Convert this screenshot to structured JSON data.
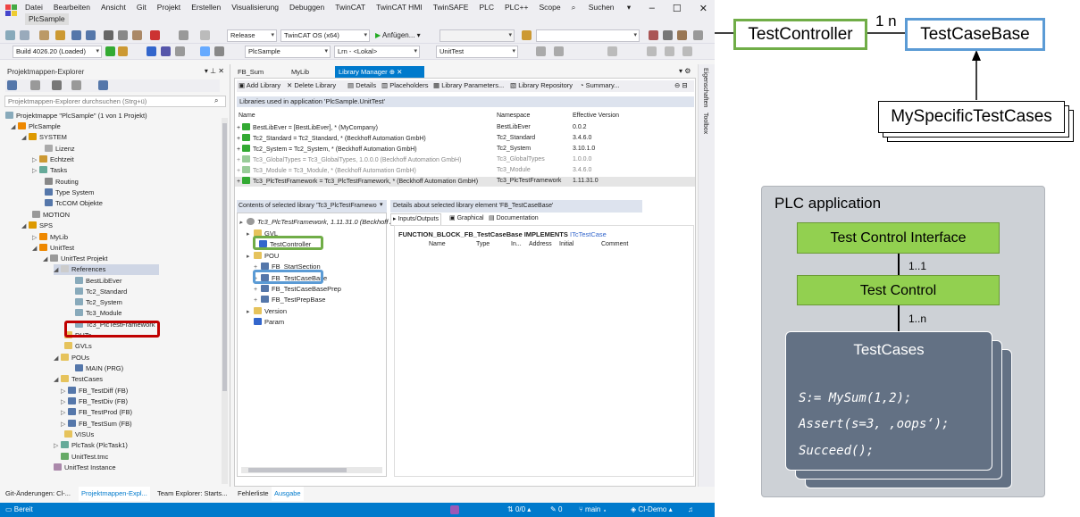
{
  "menu": {
    "items": [
      "Datei",
      "Bearbeiten",
      "Ansicht",
      "Git",
      "Projekt",
      "Erstellen",
      "Visualisierung",
      "Debuggen",
      "TwinCAT",
      "TwinCAT HMI",
      "TwinSAFE",
      "PLC",
      "PLC++",
      "Scope"
    ],
    "items2": [
      "Extras",
      "Fenster",
      "Hilfe"
    ],
    "search": "Suchen",
    "window_title": "PlcSample"
  },
  "toolbar": {
    "config": "Release",
    "platform": "TwinCAT OS (x64)",
    "start": "Anfügen...",
    "build": "Build 4026.20 (Loaded)",
    "project": "PlcSample",
    "target": "Lrn - <Lokal>",
    "task": "UnitTest"
  },
  "explorer": {
    "title": "Projektmappen-Explorer",
    "search_placeholder": "Projektmappen-Explorer durchsuchen (Strg+ü)",
    "items": [
      "Projektmappe \"PlcSample\" (1 von 1 Projekt)",
      "PlcSample",
      "SYSTEM",
      "Lizenz",
      "Echtzeit",
      "Tasks",
      "Routing",
      "Type System",
      "TcCOM Objekte",
      "MOTION",
      "SPS",
      "MyLib",
      "UnitTest",
      "UnitTest Projekt",
      "References",
      "BestLibEver",
      "Tc2_Standard",
      "Tc2_System",
      "Tc3_Module",
      "Tc3_PlcTestFramework",
      "DUTs",
      "GVLs",
      "POUs",
      "MAIN (PRG)",
      "TestCases",
      "FB_TestDiff (FB)",
      "FB_TestDiv (FB)",
      "FB_TestProd (FB)",
      "FB_TestSum (FB)",
      "VISUs",
      "PlcTask (PlcTask1)",
      "UnitTest.tmc",
      "UnitTest Instance"
    ]
  },
  "tabs": [
    "FB_Sum",
    "MyLib",
    "Library Manager"
  ],
  "side_tabs": [
    "Eigenschaften",
    "Toolbox"
  ],
  "lm": {
    "actions": [
      "Add Library",
      "Delete Library",
      "Details",
      "Placeholders",
      "Library Parameters...",
      "Library Repository",
      "Summary..."
    ],
    "section": "Libraries used in application 'PlcSample.UnitTest'",
    "cols": [
      "Name",
      "Namespace",
      "Effective Version"
    ],
    "rows": [
      [
        "BestLibEver = [BestLibEver], * (MyCompany)",
        "BestLibEver",
        "0.0.2"
      ],
      [
        "Tc2_Standard = Tc2_Standard, * (Beckhoff Automation GmbH)",
        "Tc2_Standard",
        "3.4.6.0"
      ],
      [
        "Tc2_System = Tc2_System, * (Beckhoff Automation GmbH)",
        "Tc2_System",
        "3.10.1.0"
      ],
      [
        "Tc3_GlobalTypes = Tc3_GlobalTypes, 1.0.0.0 (Beckhoff Automation GmbH)",
        "Tc3_GlobalTypes",
        "1.0.0.0"
      ],
      [
        "Tc3_Module = Tc3_Module, * (Beckhoff Automation GmbH)",
        "Tc3_Module",
        "3.4.6.0"
      ],
      [
        "Tc3_PlcTestFramework = Tc3_PlcTestFramework, * (Beckhoff Automation GmbH)",
        "Tc3_PlcTestFramework",
        "1.11.31.0"
      ]
    ],
    "contents_title": "Contents of selected library 'Tc3_PlcTestFramewo",
    "details_title": "Details about selected library element 'FB_TestCaseBase'",
    "detail_tabs": [
      "Inputs/Outputs",
      "Graphical",
      "Documentation"
    ],
    "lib_root": "Tc3_PlcTestFramework, 1.11.31.0 (Beckhoff Au",
    "lib_items": [
      "GVL",
      "TestController",
      "POU",
      "FB_StartSection",
      "FB_TestCaseBase",
      "FB_TestCaseBasePrep",
      "FB_TestPrepBase",
      "Version",
      "Param"
    ],
    "fb_decl": "FUNCTION_BLOCK_FB_TestCaseBase IMPLEMENTS",
    "fb_iface": "ITcTestCase",
    "detail_cols": [
      "Name",
      "Type",
      "In...",
      "Address",
      "Initial",
      "Comment"
    ]
  },
  "bottom_tabs": [
    "Git-Änderungen: Cl-...",
    "Projektmappen-Expl...",
    "Team Explorer: Starts...",
    "Fehlerliste",
    "Ausgabe"
  ],
  "status": {
    "ready": "Bereit",
    "updown": "0/0",
    "pencil": "0",
    "branch": "main",
    "repo": "CI-Demo"
  },
  "diagram": {
    "controller": "TestController",
    "mult": "1 n",
    "base": "TestCaseBase",
    "specific": "MySpecificTestCases"
  },
  "plc": {
    "title": "PLC application",
    "iface": "Test Control Interface",
    "m1": "1..1",
    "control": "Test Control",
    "m2": "1..n",
    "cases": "TestCases",
    "code": [
      "S:= MySum(1,2);",
      "Assert(s=3, ,oops‘);",
      "Succeed();"
    ]
  },
  "colors": {
    "accent": "#007acc",
    "green_highlight": "#70ad47",
    "blue_highlight": "#5b9bd5",
    "red_highlight": "#c00000"
  }
}
